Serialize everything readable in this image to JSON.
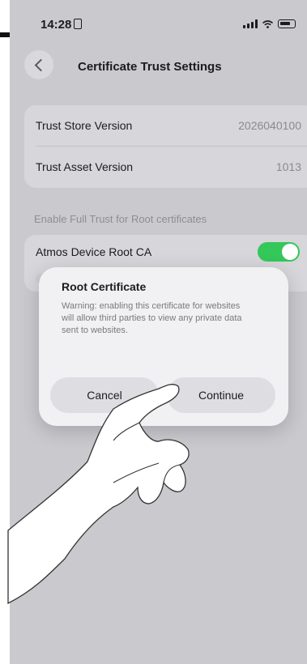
{
  "status_bar": {
    "time": "14:28"
  },
  "nav": {
    "title": "Certificate Trust Settings"
  },
  "versions": [
    {
      "label": "Trust Store Version",
      "value": "2026040100"
    },
    {
      "label": "Trust Asset Version",
      "value": "1013"
    }
  ],
  "trust_section": {
    "header": "Enable Full Trust for Root certificates",
    "certificate_name": "Atmos Device Root CA",
    "toggle_on": true
  },
  "alert": {
    "title": "Root Certificate",
    "message": "Warning: enabling this certificate for websites will allow third parties to view any private data sent to websites.",
    "cancel_label": "Cancel",
    "continue_label": "Continue"
  },
  "colors": {
    "toggle_on": "#34c759",
    "background": "#c9c9ce"
  }
}
